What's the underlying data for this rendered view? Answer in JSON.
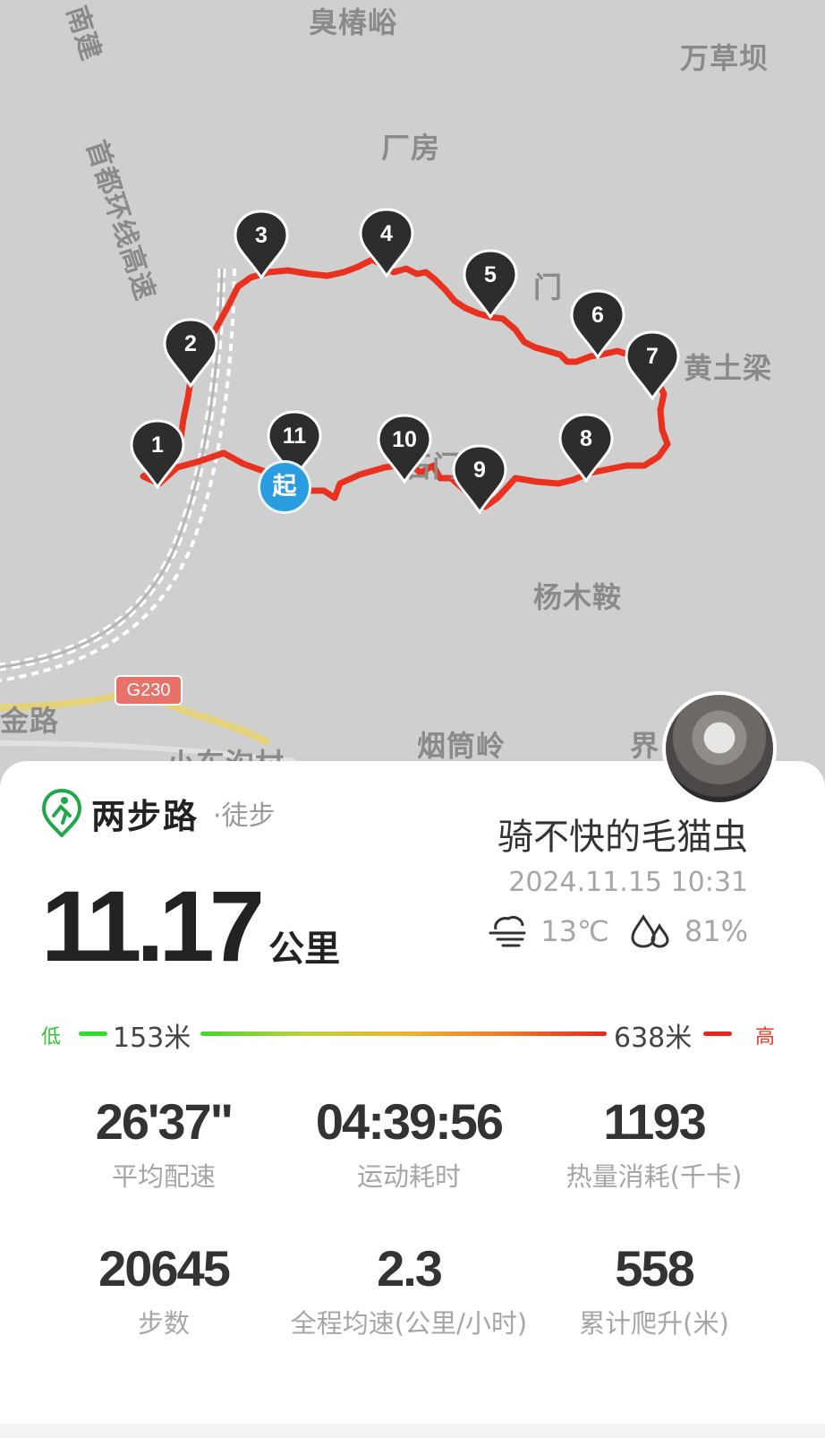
{
  "map": {
    "places": [
      "臭椿峪",
      "万草坝",
      "厂房",
      "首都环线高速",
      "门",
      "黄土梁",
      "杨木鞍",
      "金路",
      "烟筒岭",
      "界",
      "小东沟村",
      "石门",
      "南建"
    ],
    "road_badge": "G230",
    "waypoints": [
      "1",
      "2",
      "3",
      "4",
      "5",
      "6",
      "7",
      "8",
      "9",
      "10",
      "11"
    ],
    "start_label": "起",
    "route_color": "#e8311e"
  },
  "card": {
    "brand_name": "两步路",
    "activity_type": "·徒步",
    "user_name": "骑不快的毛猫虫",
    "datetime": "2024.11.15 10:31",
    "distance_value": "11.17",
    "distance_unit": "公里",
    "weather": {
      "temperature": "13℃",
      "humidity": "81%",
      "temp_icon": "cloud-wind-icon",
      "humidity_icon": "water-drops-icon"
    },
    "elevation": {
      "low_label": "低",
      "high_label": "高",
      "min": "153米",
      "max": "638米"
    },
    "stats": [
      {
        "value": "26'37\"",
        "label": "平均配速"
      },
      {
        "value": "04:39:56",
        "label": "运动耗时"
      },
      {
        "value": "1193",
        "label": "热量消耗(千卡)"
      },
      {
        "value": "20645",
        "label": "步数"
      },
      {
        "value": "2.3",
        "label": "全程均速(公里/小时)"
      },
      {
        "value": "558",
        "label": "累计爬升(米)"
      }
    ],
    "brand_color": "#1fa84a"
  }
}
